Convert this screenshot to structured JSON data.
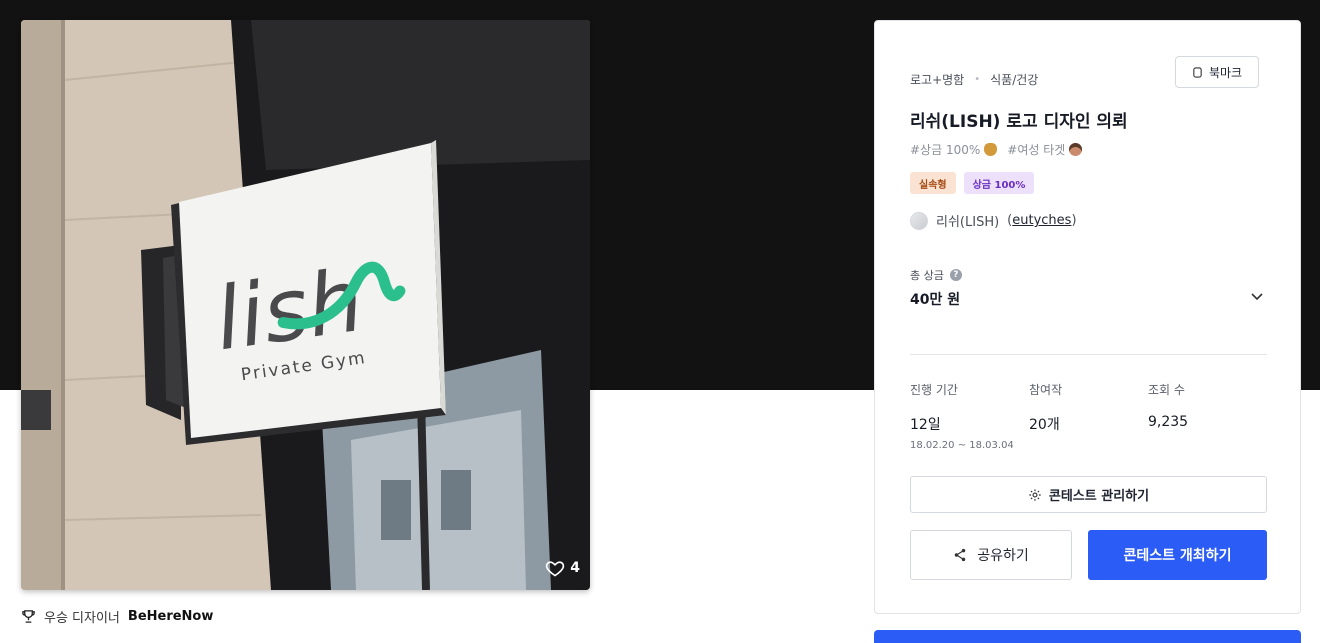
{
  "image": {
    "sign_logo_text": "lish",
    "sign_subtitle": "Private Gym",
    "like_count": "4"
  },
  "winner": {
    "label": "우승 디자이너",
    "name": "BeHereNow"
  },
  "contest": {
    "category": "로고+명함",
    "industry": "식품/건강",
    "bookmark_label": "북마크",
    "title": "리쉬(LISH) 로고 디자인 의뢰",
    "hashtags": [
      {
        "text": "#상금 100%",
        "icon": "money-bag-emoji"
      },
      {
        "text": "#여성 타겟",
        "icon": "woman-face-emoji"
      }
    ],
    "badges": [
      {
        "text": "실속형",
        "color": "#fbe3d3"
      },
      {
        "text": "상금 100%",
        "color": "#ece0fb"
      }
    ],
    "host_name": "리쉬(LISH)",
    "host_id": "eutyches",
    "prize_label": "총 상금",
    "prize_value": "40만 원",
    "stats": {
      "duration_label": "진행 기간",
      "duration_value": "12일",
      "duration_range": "18.02.20 ~ 18.03.04",
      "entries_label": "참여작",
      "entries_value": "20개",
      "views_label": "조회 수",
      "views_value": "9,235"
    },
    "manage_label": "콘테스트 관리하기",
    "share_label": "공유하기",
    "host_contest_label": "콘테스트 개최하기"
  },
  "colors": {
    "accent": "#2c5cf6",
    "hero_background": "#121212",
    "logo_green": "#2bbf8e"
  }
}
